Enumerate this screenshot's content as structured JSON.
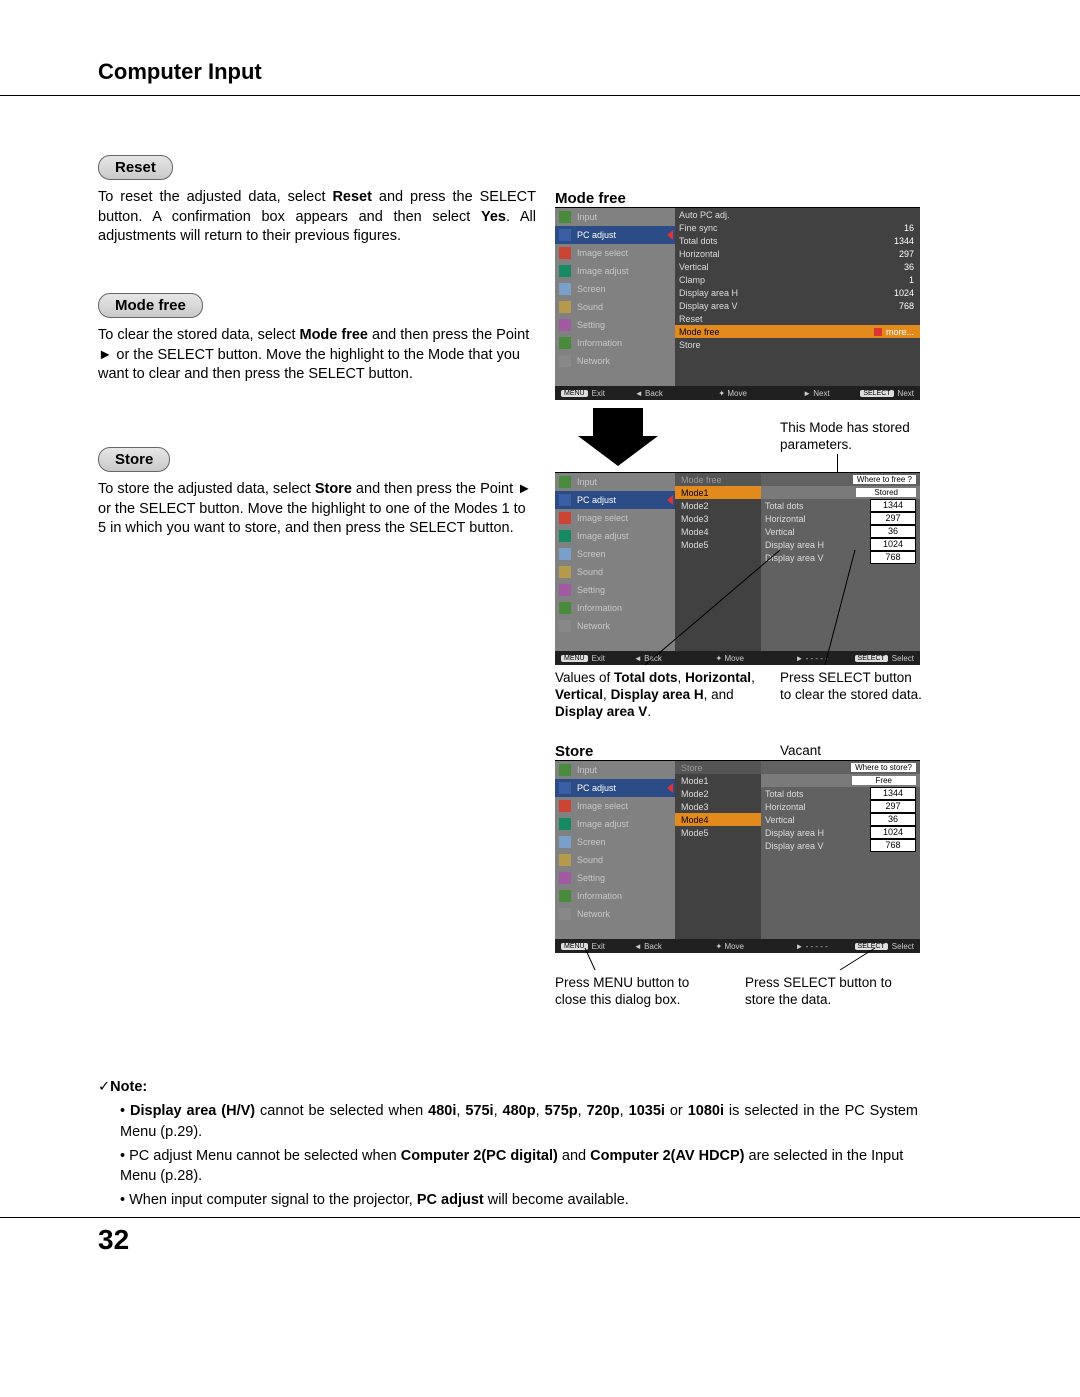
{
  "page": {
    "title": "Computer Input",
    "number": "32"
  },
  "sections": {
    "reset": {
      "heading": "Reset",
      "p1a": "To reset the adjusted data, select ",
      "p1b": "Reset",
      "p1c": " and press the SELECT button. A confirmation box appears and then select ",
      "p1d": "Yes",
      "p1e": ". All adjustments will return to their previous figures."
    },
    "modefree": {
      "heading": "Mode free",
      "p1a": "To clear the stored data, select ",
      "p1b": "Mode free",
      "p1c": " and then press the Point ► or the SELECT button. Move the highlight to the Mode that you want to clear and then press the SELECT button."
    },
    "store": {
      "heading": "Store",
      "p1a": "To store the adjusted data, select ",
      "p1b": "Store",
      "p1c": " and then press the Point ► or the SELECT button. Move the highlight to one of the Modes 1 to 5 in which you want to store, and then press the SELECT button."
    }
  },
  "right": {
    "modefree_title": "Mode free",
    "store_title": "Store",
    "vacant": "Vacant"
  },
  "osd_menu": {
    "items": [
      "Input",
      "PC adjust",
      "Image select",
      "Image adjust",
      "Screen",
      "Sound",
      "Setting",
      "Information",
      "Network"
    ]
  },
  "osd1": {
    "params": [
      {
        "l": "Auto PC adj.",
        "v": ""
      },
      {
        "l": "Fine sync",
        "v": "16"
      },
      {
        "l": "Total dots",
        "v": "1344"
      },
      {
        "l": "Horizontal",
        "v": "297"
      },
      {
        "l": "Vertical",
        "v": "36"
      },
      {
        "l": "Clamp",
        "v": "1"
      },
      {
        "l": "Display area H",
        "v": "1024"
      },
      {
        "l": "Display area V",
        "v": "768"
      },
      {
        "l": "Reset",
        "v": ""
      }
    ],
    "hl": {
      "l": "Mode free",
      "v": "more..."
    },
    "after": {
      "l": "Store",
      "v": ""
    },
    "footer": {
      "exit": "Exit",
      "back": "Back",
      "move": "Move",
      "next": "Next",
      "sel": "Next"
    }
  },
  "osd2": {
    "head": "Mode free",
    "q": "Where to free ?",
    "sub": "Stored",
    "modes": [
      "Mode1",
      "Mode2",
      "Mode3",
      "Mode4",
      "Mode5"
    ],
    "params": [
      {
        "l": "Total dots",
        "v": "1344"
      },
      {
        "l": "Horizontal",
        "v": "297"
      },
      {
        "l": "Vertical",
        "v": "36"
      },
      {
        "l": "Display area H",
        "v": "1024"
      },
      {
        "l": "Display area V",
        "v": "768"
      }
    ],
    "footer": {
      "exit": "Exit",
      "back": "Back",
      "move": "Move",
      "next": "- - - - -",
      "sel": "Select"
    }
  },
  "osd3": {
    "head": "Store",
    "q": "Where to store?",
    "sub": "Free",
    "modes": [
      "Mode1",
      "Mode2",
      "Mode3",
      "Mode4",
      "Mode5"
    ],
    "hl_mode": "Mode4",
    "params": [
      {
        "l": "Total dots",
        "v": "1344"
      },
      {
        "l": "Horizontal",
        "v": "297"
      },
      {
        "l": "Vertical",
        "v": "36"
      },
      {
        "l": "Display area H",
        "v": "1024"
      },
      {
        "l": "Display area V",
        "v": "768"
      }
    ],
    "footer": {
      "exit": "Exit",
      "back": "Back",
      "move": "Move",
      "next": "- - - - -",
      "sel": "Select"
    }
  },
  "callouts": {
    "c1": "This Mode has stored parameters.",
    "c2a": "Values of ",
    "c2b": "Total dots",
    "c2c": ", ",
    "c2d": "Horizontal",
    "c2e": ", ",
    "c2f": "Vertical",
    "c2g": ", ",
    "c2h": "Display area H",
    "c2i": ", and ",
    "c2j": "Display area V",
    "c2k": ".",
    "c3": "Press SELECT button to clear the stored data.",
    "c4": "Press MENU button to close this dialog box.",
    "c5": "Press SELECT button to store the data."
  },
  "note": {
    "head": "Note:",
    "n1a": "Display area (H/V)",
    "n1b": " cannot be selected when ",
    "n1c": "480i",
    "n1d": ", ",
    "n1e": "575i",
    "n1f": ", ",
    "n1g": "480p",
    "n1h": ", ",
    "n1i": "575p",
    "n1j": ", ",
    "n1k": "720p",
    "n1l": ", ",
    "n1m": "1035i",
    "n1n": " or ",
    "n1o": "1080i",
    "n1p": " is selected in the PC System Menu (p.29).",
    "n2a": "PC adjust Menu cannot be selected when ",
    "n2b": "Computer 2(PC digital)",
    "n2c": " and ",
    "n2d": "Computer 2(AV HDCP)",
    "n2e": " are selected in the Input Menu (p.28).",
    "n3a": "When input computer signal to the projector, ",
    "n3b": "PC adjust",
    "n3c": " will become available."
  },
  "labels": {
    "menu": "MENU",
    "select": "SELECT"
  }
}
